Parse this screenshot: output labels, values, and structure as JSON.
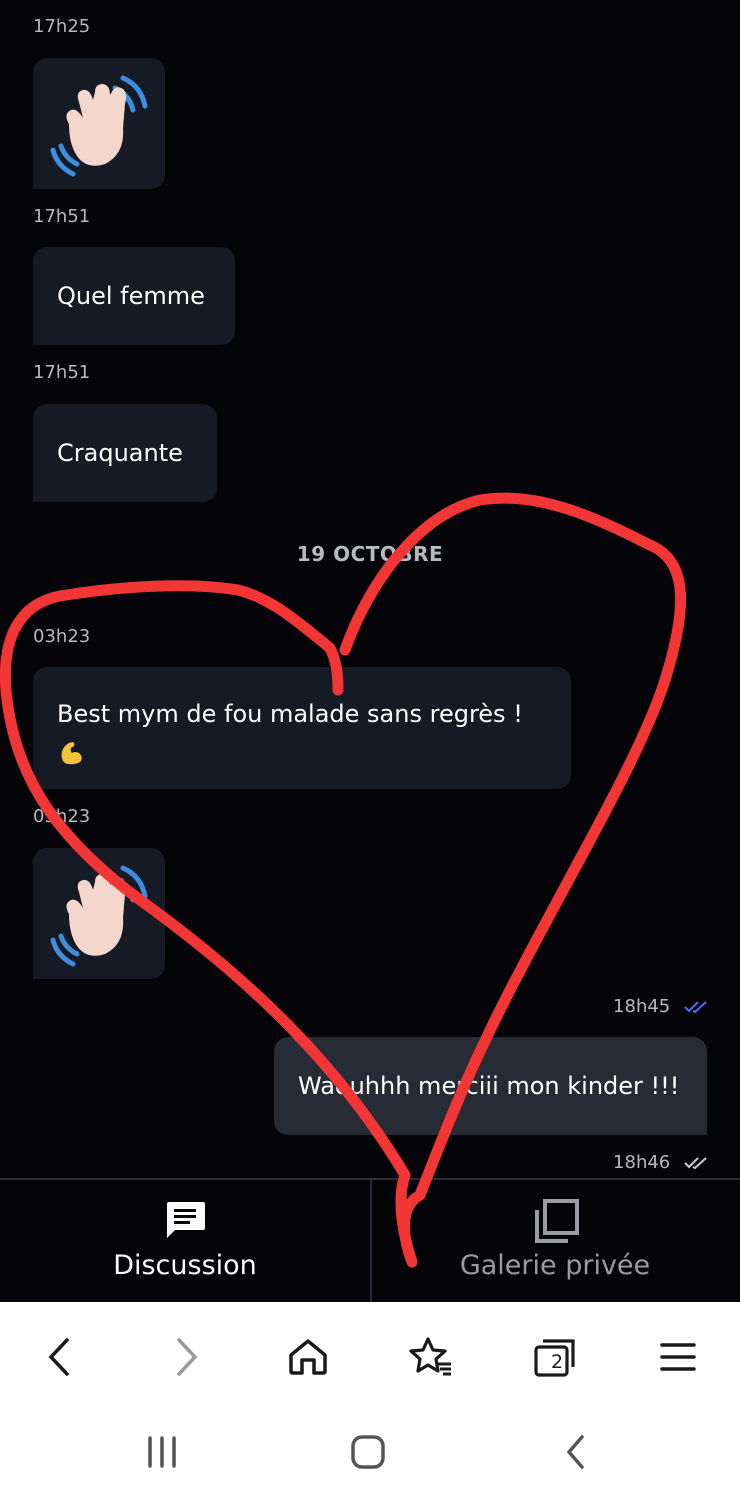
{
  "messages": [
    {
      "time": "17h25",
      "type": "emoji",
      "emoji": "waving-hand"
    },
    {
      "time": "17h51",
      "type": "text",
      "text": "Quel femme"
    },
    {
      "time": "17h51",
      "type": "text",
      "text": "Craquante"
    },
    {
      "separator": "19 OCTOBRE"
    },
    {
      "time": "03h23",
      "type": "text",
      "text": "Best mym de fou malade sans regrès !",
      "emoji": "flexed-biceps"
    },
    {
      "time": "03h23",
      "type": "emoji",
      "emoji": "waving-hand"
    },
    {
      "time": "18h45",
      "type": "text",
      "outgoing": true,
      "text": "Waouhhh merciii mon kinder !!!",
      "status": "read"
    },
    {
      "time": "18h46",
      "outgoing": true,
      "status": "delivered"
    }
  ],
  "tabs": [
    {
      "label": "Discussion",
      "icon": "chat-icon",
      "active": true
    },
    {
      "label": "Galerie privée",
      "icon": "gallery-icon",
      "active": false
    }
  ],
  "browser_toolbar": {
    "tab_count": "2"
  },
  "colors": {
    "background": "#050509",
    "bubble": "#161a24",
    "outgoing_bubble": "#272b36",
    "read_ticks": "#4a6cf7",
    "overlay": "#f23535"
  }
}
